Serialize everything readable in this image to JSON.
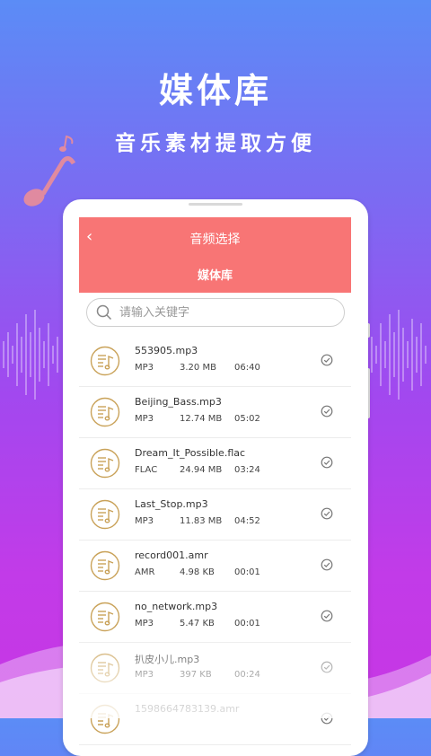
{
  "hero": {
    "title": "媒体库",
    "subtitle": "音乐素材提取方便"
  },
  "header": {
    "title": "音频选择",
    "back_icon": "‹",
    "tab": "媒体库"
  },
  "search": {
    "placeholder": "请输入关键字"
  },
  "files": [
    {
      "name": "553905.mp3",
      "type": "MP3",
      "size": "3.20 MB",
      "duration": "06:40"
    },
    {
      "name": "Beijing_Bass.mp3",
      "type": "MP3",
      "size": "12.74 MB",
      "duration": "05:02"
    },
    {
      "name": "Dream_It_Possible.flac",
      "type": "FLAC",
      "size": "24.94 MB",
      "duration": "03:24"
    },
    {
      "name": "Last_Stop.mp3",
      "type": "MP3",
      "size": "11.83 MB",
      "duration": "04:52"
    },
    {
      "name": "record001.amr",
      "type": "AMR",
      "size": "4.98 KB",
      "duration": "00:01"
    },
    {
      "name": "no_network.mp3",
      "type": "MP3",
      "size": "5.47 KB",
      "duration": "00:01"
    },
    {
      "name": "扒皮小儿.mp3",
      "type": "MP3",
      "size": "397 KB",
      "duration": "00:24"
    },
    {
      "name": "159866478313​9.amr",
      "type": "",
      "size": "",
      "duration": ""
    }
  ],
  "colors": {
    "header": "#f87575",
    "icon_gold": "#c9a259",
    "bg_top": "#5b8cf6",
    "bg_bottom": "#c736e4"
  }
}
